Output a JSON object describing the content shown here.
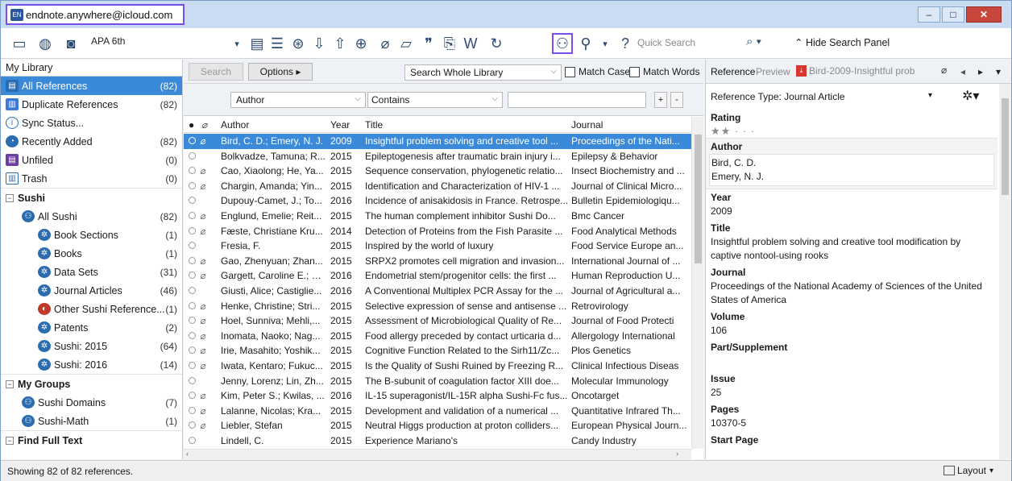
{
  "window": {
    "title": "endnote.anywhere@icloud.com",
    "app_badge": "EN"
  },
  "toolbar": {
    "style": "APA 6th",
    "quick_search": "Quick Search",
    "hide_panel": "Hide Search Panel"
  },
  "library": {
    "header": "My Library",
    "groups": [
      {
        "label": "All References",
        "count": "(82)",
        "icon": "all-references-icon"
      },
      {
        "label": "Duplicate References",
        "count": "(82)",
        "icon": "duplicate-icon"
      },
      {
        "label": "Sync Status...",
        "count": "",
        "icon": "info-icon"
      },
      {
        "label": "Recently Added",
        "count": "(82)",
        "icon": "clock-icon"
      },
      {
        "label": "Unfiled",
        "count": "(0)",
        "icon": "unfiled-icon"
      },
      {
        "label": "Trash",
        "count": "(0)",
        "icon": "trash-icon"
      }
    ],
    "sections": {
      "sushi": "Sushi",
      "my_groups": "My Groups",
      "find_full_text": "Find Full Text"
    },
    "sushi_items": [
      {
        "label": "All Sushi",
        "count": "(82)"
      },
      {
        "label": "Book Sections",
        "count": "(1)"
      },
      {
        "label": "Books",
        "count": "(1)"
      },
      {
        "label": "Data Sets",
        "count": "(31)"
      },
      {
        "label": "Journal Articles",
        "count": "(46)"
      },
      {
        "label": "Other Sushi Reference...",
        "count": "(1)"
      },
      {
        "label": "Patents",
        "count": "(2)"
      },
      {
        "label": "Sushi: 2015",
        "count": "(64)"
      },
      {
        "label": "Sushi: 2016",
        "count": "(14)"
      }
    ],
    "my_groups_items": [
      {
        "label": "Sushi Domains",
        "count": "(7)"
      },
      {
        "label": "Sushi-Math",
        "count": "(1)"
      }
    ]
  },
  "search": {
    "search_label": "Search",
    "options_label": "Options ▸",
    "scope": "Search Whole Library",
    "match_case": "Match Case",
    "match_words": "Match Words",
    "field": "Author",
    "operator": "Contains",
    "plus": "+",
    "minus": "-"
  },
  "table": {
    "headers": {
      "author": "Author",
      "year": "Year",
      "title": "Title",
      "journal": "Journal"
    },
    "rows": [
      {
        "author": "Bird, C. D.; Emery, N. J.",
        "year": "2009",
        "title": "Insightful problem solving and creative tool ...",
        "journal": "Proceedings of the Nati...",
        "clip": true
      },
      {
        "author": "Bolkvadze, Tamuna; R...",
        "year": "2015",
        "title": "Epileptogenesis after traumatic brain injury i...",
        "journal": "Epilepsy & Behavior",
        "clip": false
      },
      {
        "author": "Cao, Xiaolong; He, Ya...",
        "year": "2015",
        "title": "Sequence conservation, phylogenetic relatio...",
        "journal": "Insect Biochemistry and ...",
        "clip": true
      },
      {
        "author": "Chargin, Amanda; Yin...",
        "year": "2015",
        "title": "Identification and Characterization of HIV-1 ...",
        "journal": "Journal of Clinical Micro...",
        "clip": true
      },
      {
        "author": "Dupouy-Camet, J.; To...",
        "year": "2016",
        "title": "Incidence of anisakidosis in France. Retrospe...",
        "journal": "Bulletin Epidemiologiqu...",
        "clip": false
      },
      {
        "author": "Englund, Emelie; Reit...",
        "year": "2015",
        "title": "The human complement inhibitor Sushi Do...",
        "journal": "Bmc Cancer",
        "clip": true
      },
      {
        "author": "Fæste, Christiane Kru...",
        "year": "2014",
        "title": "Detection of Proteins from the Fish Parasite ...",
        "journal": "Food Analytical Methods",
        "clip": true
      },
      {
        "author": "Fresia, F.",
        "year": "2015",
        "title": "Inspired by the world of luxury",
        "journal": "Food Service Europe an...",
        "clip": false
      },
      {
        "author": "Gao, Zhenyuan; Zhan...",
        "year": "2015",
        "title": "SRPX2 promotes cell migration and invasion...",
        "journal": "International Journal of ...",
        "clip": true
      },
      {
        "author": "Gargett, Caroline E.; S...",
        "year": "2016",
        "title": "Endometrial stem/progenitor cells: the first ...",
        "journal": "Human Reproduction U...",
        "clip": true
      },
      {
        "author": "Giusti, Alice; Castiglie...",
        "year": "2016",
        "title": "A Conventional Multiplex PCR Assay for the ...",
        "journal": "Journal of Agricultural a...",
        "clip": false
      },
      {
        "author": "Henke, Christine; Stri...",
        "year": "2015",
        "title": "Selective expression of sense and antisense ...",
        "journal": "Retrovirology",
        "clip": true
      },
      {
        "author": "Hoel, Sunniva; Mehli,...",
        "year": "2015",
        "title": "Assessment of Microbiological Quality of Re...",
        "journal": "Journal of Food Protecti",
        "clip": true
      },
      {
        "author": "Inomata, Naoko; Nag...",
        "year": "2015",
        "title": "Food allergy preceded by contact urticaria d...",
        "journal": "Allergology International",
        "clip": true
      },
      {
        "author": "Irie, Masahito; Yoshik...",
        "year": "2015",
        "title": "Cognitive Function Related to the Sirh11/Zc...",
        "journal": "Plos Genetics",
        "clip": true
      },
      {
        "author": "Iwata, Kentaro; Fukuc...",
        "year": "2015",
        "title": "Is the Quality of Sushi Ruined by Freezing R...",
        "journal": "Clinical Infectious Diseas",
        "clip": true
      },
      {
        "author": "Jenny, Lorenz; Lin, Zh...",
        "year": "2015",
        "title": "The B-subunit of coagulation factor XIII doe...",
        "journal": "Molecular Immunology",
        "clip": false
      },
      {
        "author": "Kim, Peter S.; Kwilas, ...",
        "year": "2016",
        "title": "IL-15 superagonist/IL-15R alpha Sushi-Fc fus...",
        "journal": "Oncotarget",
        "clip": true
      },
      {
        "author": "Lalanne, Nicolas; Kra...",
        "year": "2015",
        "title": "Development and validation of a numerical ...",
        "journal": "Quantitative Infrared Th...",
        "clip": true
      },
      {
        "author": "Liebler, Stefan",
        "year": "2015",
        "title": "Neutral Higgs production at proton colliders...",
        "journal": "European Physical Journ...",
        "clip": true
      },
      {
        "author": "Lindell, C.",
        "year": "2015",
        "title": "Experience Mariano's",
        "journal": "Candy Industry",
        "clip": false
      }
    ]
  },
  "reference": {
    "tabs": {
      "reference": "Reference",
      "preview": "Preview",
      "pdf": "Bird-2009-Insightful prob"
    },
    "type_label": "Reference Type: Journal Article",
    "rating_label": "Rating",
    "rating_value": 2,
    "rating_max": 5,
    "author_label": "Author",
    "authors": [
      "Bird, C. D.",
      "Emery, N. J."
    ],
    "year_label": "Year",
    "year": "2009",
    "title_label": "Title",
    "title": "Insightful problem solving and creative tool modification by captive nontool-using rooks",
    "journal_label": "Journal",
    "journal": "Proceedings of the National Academy of Sciences of the United States of America",
    "volume_label": "Volume",
    "volume": "106",
    "part_label": "Part/Supplement",
    "issue_label": "Issue",
    "issue": "25",
    "pages_label": "Pages",
    "pages": "10370-5",
    "start_page_label": "Start Page"
  },
  "status": {
    "text": "Showing 82 of 82 references.",
    "layout": "Layout"
  },
  "colors": {
    "accent": "#3b8ad9",
    "highlight": "#7b4de8"
  }
}
